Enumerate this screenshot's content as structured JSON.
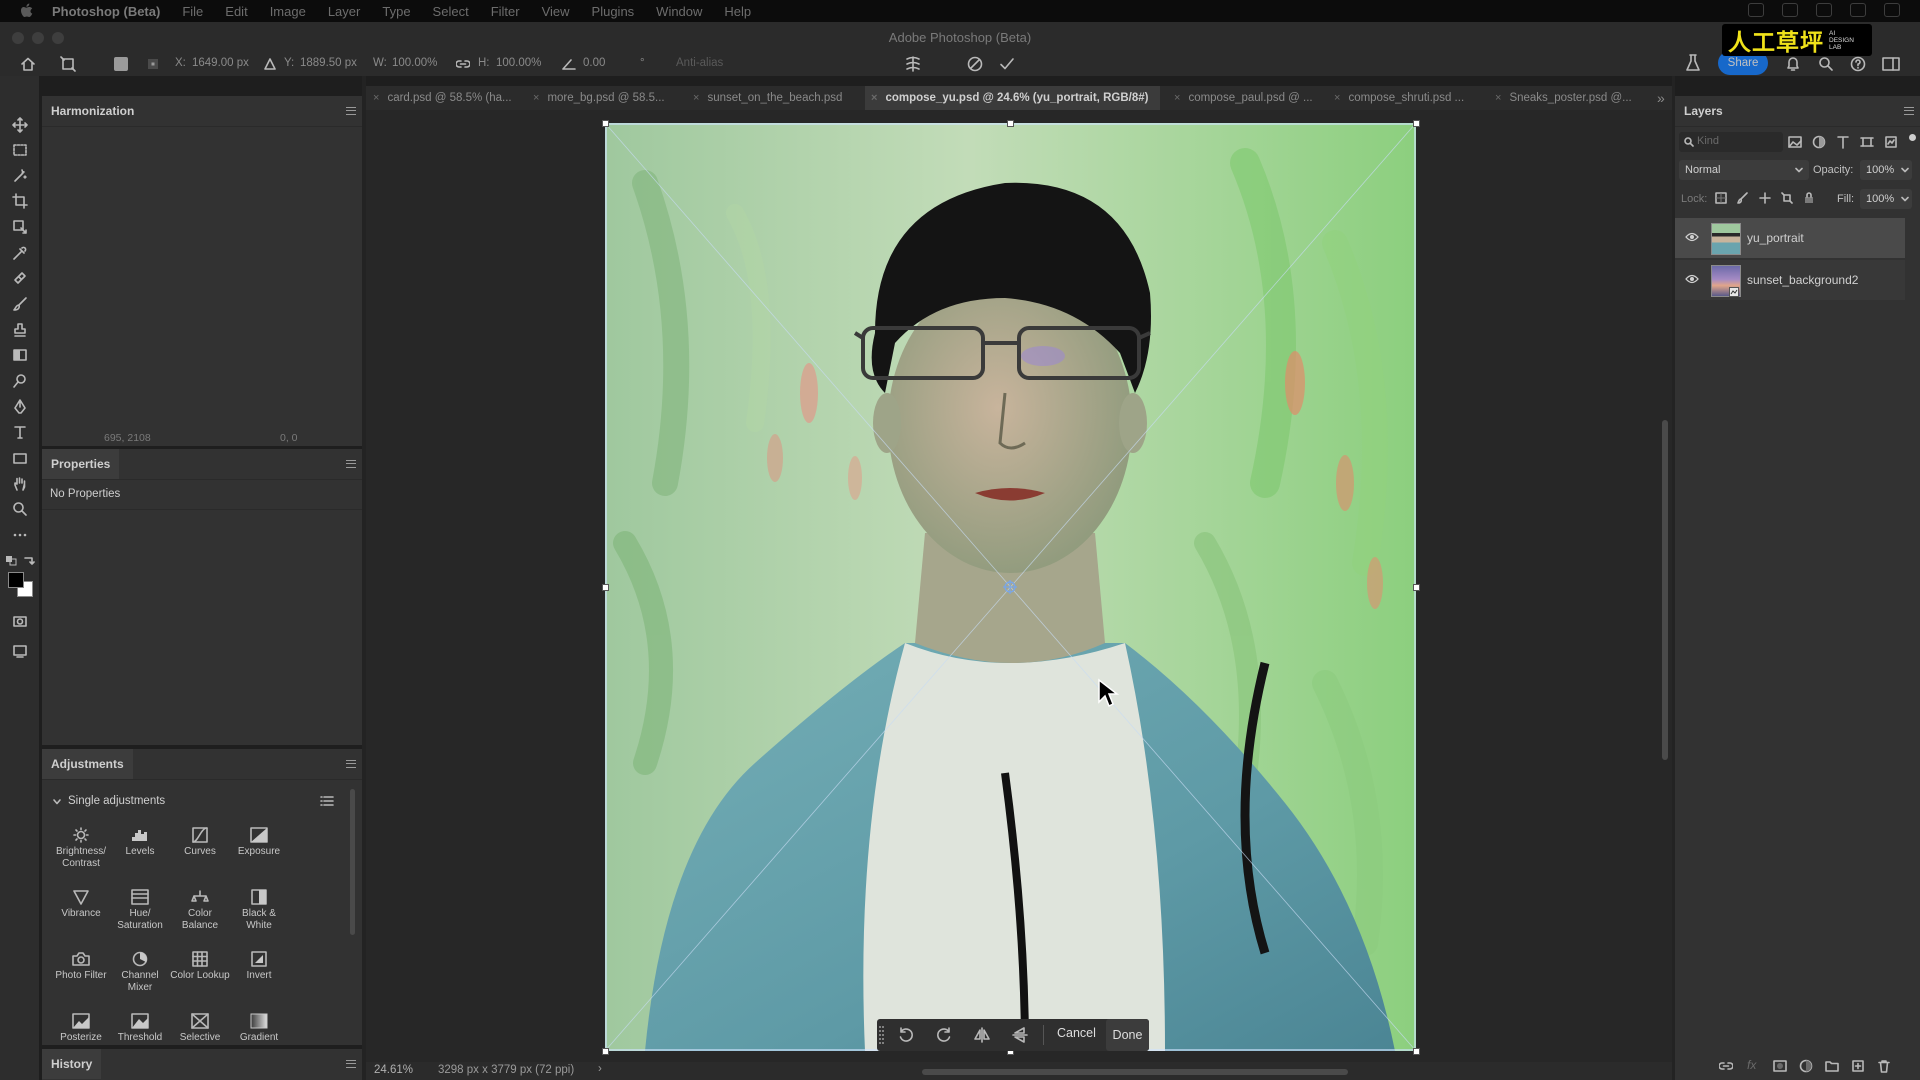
{
  "menubar": {
    "app": "Photoshop (Beta)",
    "items": [
      "File",
      "Edit",
      "Image",
      "Layer",
      "Type",
      "Select",
      "Filter",
      "View",
      "Plugins",
      "Window",
      "Help"
    ]
  },
  "window": {
    "title": "Adobe Photoshop (Beta)"
  },
  "options": {
    "x_label": "X:",
    "x_value": "1649.00 px",
    "y_label": "Y:",
    "y_value": "1889.50 px",
    "w_label": "W:",
    "w_value": "100.00%",
    "h_label": "H:",
    "h_value": "100.00%",
    "angle_value": "0.00",
    "angle_unit": "°",
    "antialias": "Anti-alias",
    "share": "Share"
  },
  "brand": {
    "zh": "人工草坪",
    "en_line1": "AI",
    "en_line2": "DESIGN",
    "en_line3": "LAB"
  },
  "harmonization": {
    "tab": "Harmonization",
    "coord_left": "695, 2108",
    "coord_right": "0, 0"
  },
  "properties": {
    "tab": "Properties",
    "empty": "No Properties"
  },
  "adjustments": {
    "tab": "Adjustments",
    "section": "Single adjustments",
    "items": [
      "Brightness/ Contrast",
      "Levels",
      "Curves",
      "Exposure",
      "Vibrance",
      "Hue/ Saturation",
      "Color Balance",
      "Black & White",
      "Photo Filter",
      "Channel Mixer",
      "Color Lookup",
      "Invert",
      "Posterize",
      "Threshold",
      "Selective",
      "Gradient"
    ]
  },
  "history": {
    "tab": "History"
  },
  "doc_tabs": [
    "card.psd @ 58.5% (ha...",
    "more_bg.psd @ 58.5...",
    "sunset_on_the_beach.psd",
    "compose_yu.psd @ 24.6% (yu_portrait, RGB/8#)",
    "compose_paul.psd @ ...",
    "compose_shruti.psd ...",
    "Sneaks_poster.psd @..."
  ],
  "status": {
    "zoom": "24.61%",
    "doc_size": "3298 px x 3779 px (72 ppi)"
  },
  "transform_bar": {
    "cancel": "Cancel",
    "done": "Done"
  },
  "layers": {
    "tab": "Layers",
    "search_placeholder": "Kind",
    "blend_mode": "Normal",
    "opacity_label": "Opacity:",
    "opacity_value": "100%",
    "lock_label": "Lock:",
    "fill_label": "Fill:",
    "fill_value": "100%",
    "items": [
      {
        "name": "yu_portrait",
        "selected": true
      },
      {
        "name": "sunset_background2",
        "selected": false
      }
    ]
  },
  "colors": {
    "accent": "#1473e6",
    "panel": "#323232",
    "canvas": "#272727",
    "brand_yellow": "#f0e21a"
  }
}
